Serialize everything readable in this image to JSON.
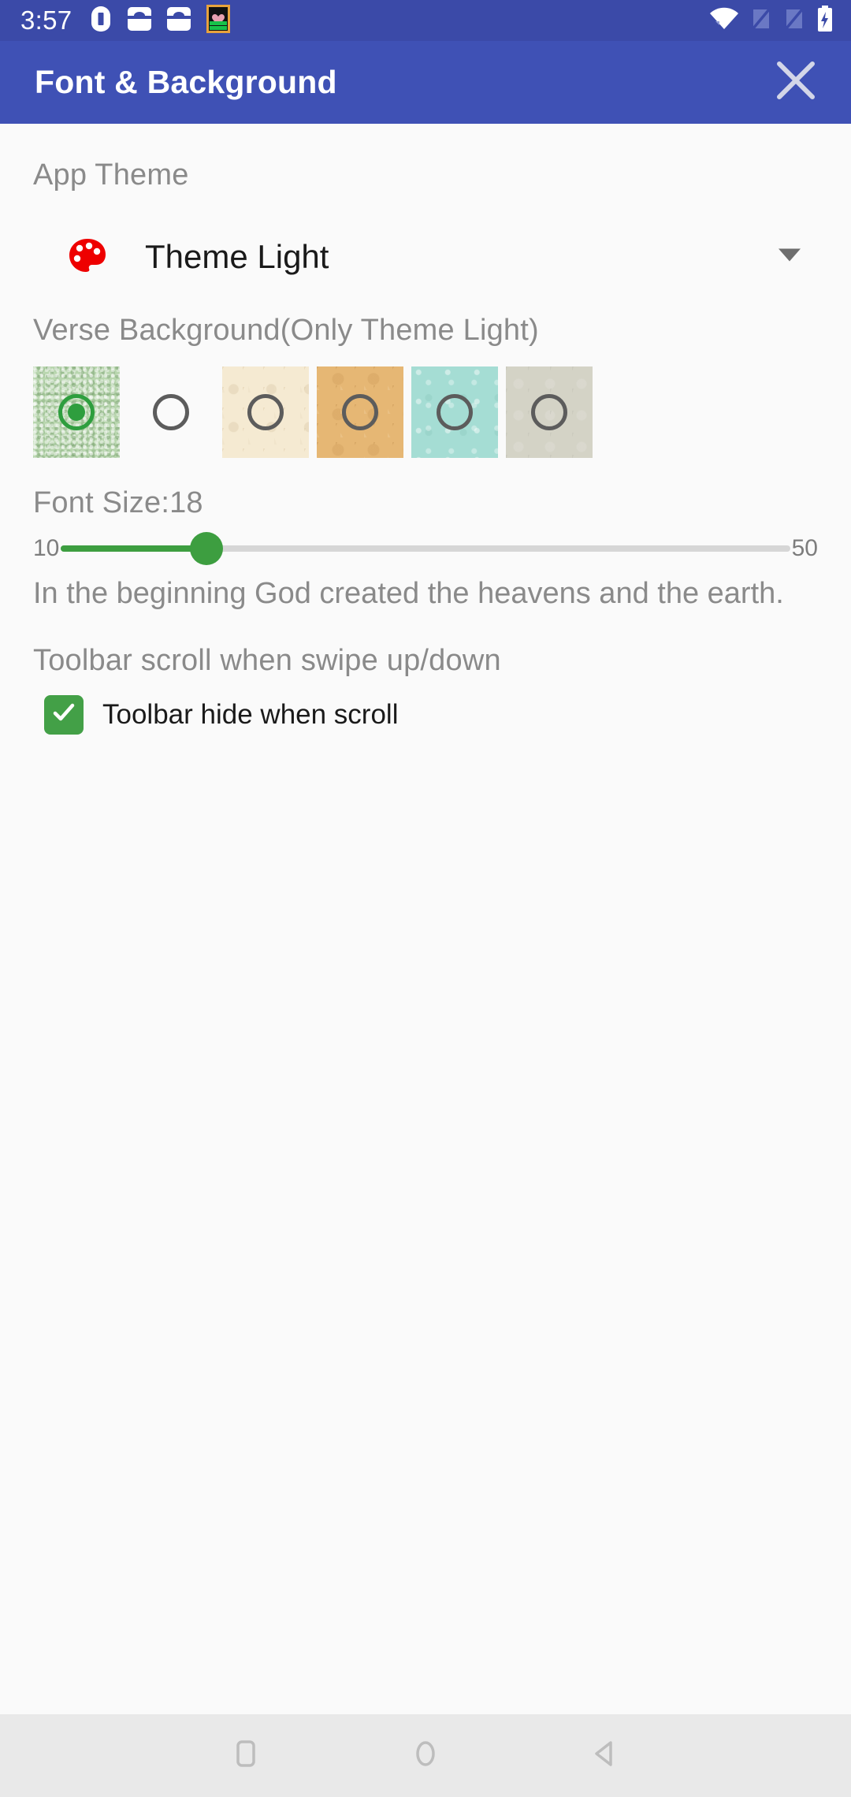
{
  "status_bar": {
    "time": "3:57",
    "background_color": "#3b4aa8",
    "left_icons": [
      {
        "name": "vpn-key-icon"
      },
      {
        "name": "sim-card-tray-icon-1"
      },
      {
        "name": "sim-card-tray-icon-2"
      },
      {
        "name": "app-notification-icon"
      }
    ],
    "right_icons": [
      {
        "name": "wifi-icon"
      },
      {
        "name": "no-sim-1-icon"
      },
      {
        "name": "no-sim-2-icon"
      },
      {
        "name": "battery-charging-icon"
      }
    ]
  },
  "app_bar": {
    "title": "Font & Background",
    "close_icon": "close-icon",
    "background_color": "#3f51b5",
    "title_color": "#ffffff"
  },
  "app_theme": {
    "label": "App Theme",
    "icon": "palette-icon",
    "icon_color": "#ee0000",
    "selected_value": "Theme Light",
    "dropdown_icon": "chevron-down-icon"
  },
  "verse_background": {
    "label": "Verse Background(Only Theme Light)",
    "selected_index": 0,
    "swatches": [
      {
        "name": "swatch-green-textured",
        "color": "#b8d6ae",
        "selected": true
      },
      {
        "name": "swatch-white",
        "color": "#fafafa",
        "selected": false
      },
      {
        "name": "swatch-cream",
        "color": "#f5ead2",
        "selected": false
      },
      {
        "name": "swatch-tan",
        "color": "#e6b774",
        "selected": false
      },
      {
        "name": "swatch-teal",
        "color": "#a5ddd4",
        "selected": false
      },
      {
        "name": "swatch-gray-beige",
        "color": "#d4d3c6",
        "selected": false
      }
    ],
    "selected_accent_color": "#2e9e3e"
  },
  "font_size": {
    "label": "Font Size:18",
    "value": 18,
    "min_label": "10",
    "max_label": "50",
    "min": 10,
    "max": 50,
    "track_color": "#d6d6d6",
    "fill_color": "#3d9e40",
    "preview_text": "In the beginning God created the heavens and the earth."
  },
  "toolbar_section": {
    "label": "Toolbar scroll when swipe up/down",
    "checkbox_label": "Toolbar hide when scroll",
    "checked": true,
    "checkbox_color": "#43a047"
  },
  "nav_bar": {
    "background_color": "#e9e9e9",
    "buttons": [
      {
        "name": "recents-button",
        "icon": "square-icon"
      },
      {
        "name": "home-button",
        "icon": "circle-icon"
      },
      {
        "name": "back-button",
        "icon": "triangle-left-icon"
      }
    ]
  }
}
